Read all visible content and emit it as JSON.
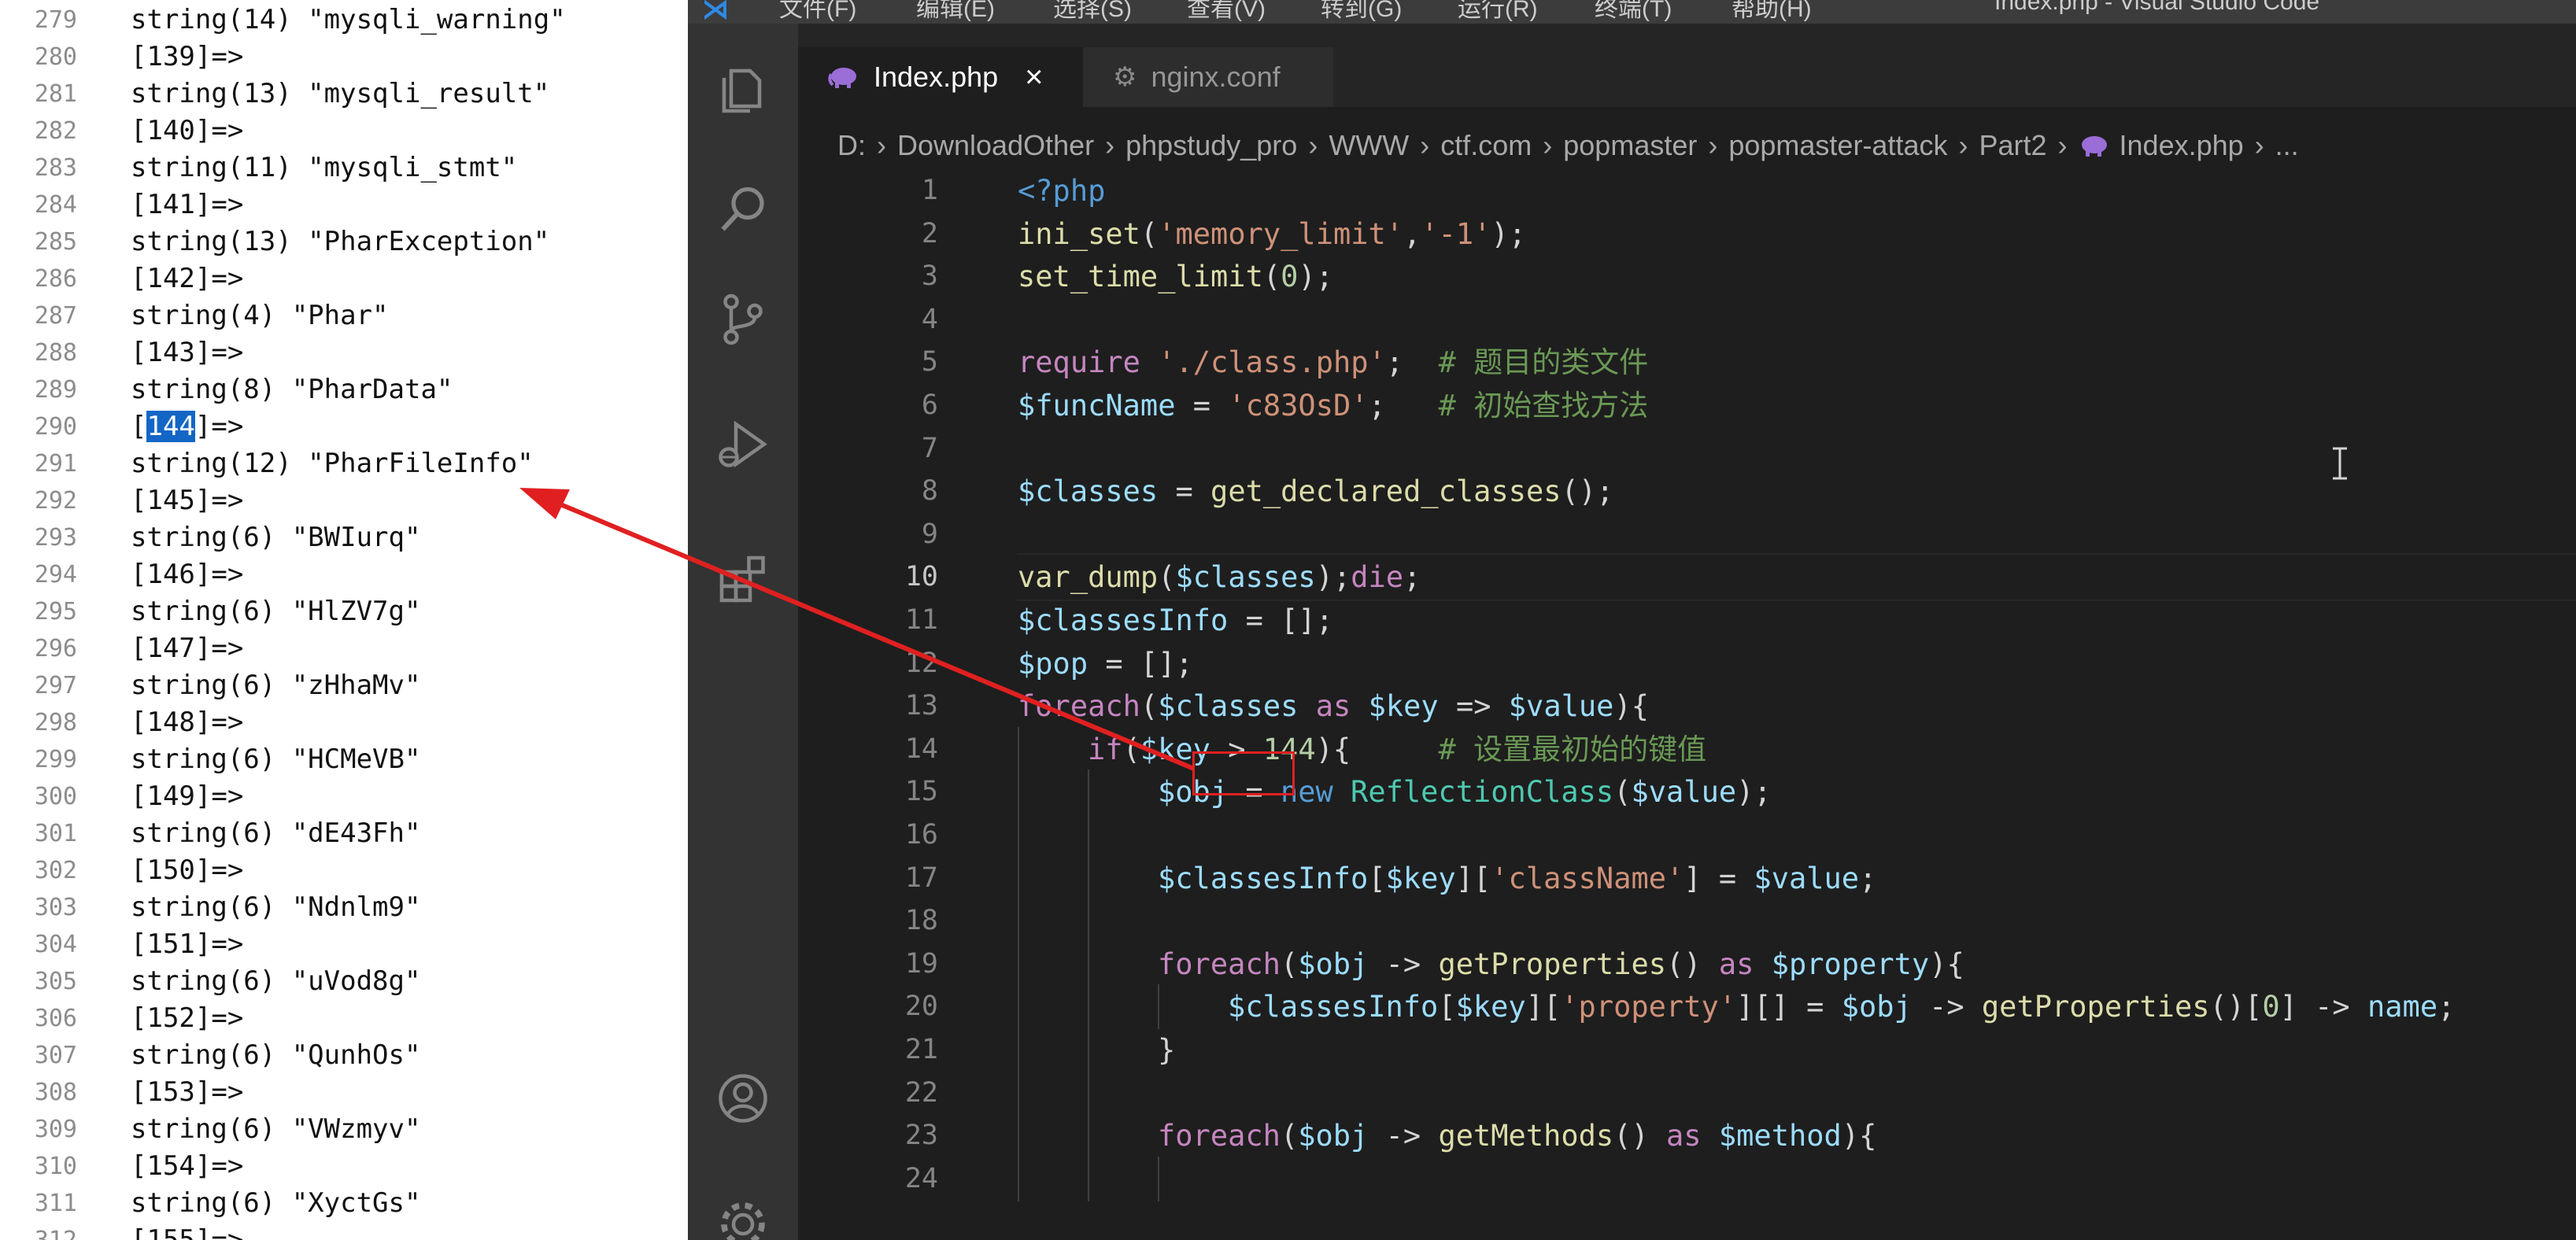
{
  "dump_panel": {
    "lines": [
      {
        "n": "279",
        "t": "string(14) \"mysqli_warning\""
      },
      {
        "n": "280",
        "t": "[139]=>"
      },
      {
        "n": "281",
        "t": "string(13) \"mysqli_result\""
      },
      {
        "n": "282",
        "t": "[140]=>"
      },
      {
        "n": "283",
        "t": "string(11) \"mysqli_stmt\""
      },
      {
        "n": "284",
        "t": "[141]=>"
      },
      {
        "n": "285",
        "t": "string(13) \"PharException\""
      },
      {
        "n": "286",
        "t": "[142]=>"
      },
      {
        "n": "287",
        "t": "string(4) \"Phar\""
      },
      {
        "n": "288",
        "t": "[143]=>"
      },
      {
        "n": "289",
        "t": "string(8) \"PharData\""
      },
      {
        "n": "290",
        "t": "]=>",
        "highlight_prefix": "[",
        "highlight": "144"
      },
      {
        "n": "291",
        "t": "string(12) \"PharFileInfo\""
      },
      {
        "n": "292",
        "t": "[145]=>"
      },
      {
        "n": "293",
        "t": "string(6) \"BWIurq\""
      },
      {
        "n": "294",
        "t": "[146]=>"
      },
      {
        "n": "295",
        "t": "string(6) \"HlZV7g\""
      },
      {
        "n": "296",
        "t": "[147]=>"
      },
      {
        "n": "297",
        "t": "string(6) \"zHhaMv\""
      },
      {
        "n": "298",
        "t": "[148]=>"
      },
      {
        "n": "299",
        "t": "string(6) \"HCMeVB\""
      },
      {
        "n": "300",
        "t": "[149]=>"
      },
      {
        "n": "301",
        "t": "string(6) \"dE43Fh\""
      },
      {
        "n": "302",
        "t": "[150]=>"
      },
      {
        "n": "303",
        "t": "string(6) \"Ndnlm9\""
      },
      {
        "n": "304",
        "t": "[151]=>"
      },
      {
        "n": "305",
        "t": "string(6) \"uVod8g\""
      },
      {
        "n": "306",
        "t": "[152]=>"
      },
      {
        "n": "307",
        "t": "string(6) \"QunhOs\""
      },
      {
        "n": "308",
        "t": "[153]=>"
      },
      {
        "n": "309",
        "t": "string(6) \"VWzmyv\""
      },
      {
        "n": "310",
        "t": "[154]=>"
      },
      {
        "n": "311",
        "t": "string(6) \"XyctGs\""
      },
      {
        "n": "312",
        "t": "[155]=>"
      }
    ]
  },
  "titlebar": {
    "menus": [
      "文件(F)",
      "编辑(E)",
      "选择(S)",
      "查看(V)",
      "转到(G)",
      "运行(R)",
      "终端(T)",
      "帮助(H)"
    ],
    "title": "Index.php - Visual Studio Code"
  },
  "activity_bar": {
    "icons": [
      "explorer-icon",
      "search-icon",
      "source-control-icon",
      "run-debug-icon",
      "extensions-icon",
      "account-icon",
      "settings-gear-icon"
    ]
  },
  "tabs": [
    {
      "label": "Index.php",
      "icon": "php-elephant-icon",
      "active": true,
      "close": "×"
    },
    {
      "label": "nginx.conf",
      "icon": "gear-file-icon",
      "active": false
    }
  ],
  "breadcrumb": {
    "parts": [
      "D:",
      "DownloadOther",
      "phpstudy_pro",
      "WWW",
      "ctf.com",
      "popmaster",
      "popmaster-attack",
      "Part2"
    ],
    "file": "Index.php",
    "ellipsis": "..."
  },
  "editor": {
    "current_line": 10,
    "lines": [
      {
        "n": "1",
        "tokens": [
          [
            "kw",
            "<?php"
          ]
        ]
      },
      {
        "n": "2",
        "tokens": [
          [
            "fn",
            "ini_set"
          ],
          [
            "txt",
            "("
          ],
          [
            "str",
            "'memory_limit'"
          ],
          [
            "txt",
            ","
          ],
          [
            "str",
            "'-1'"
          ],
          [
            "txt",
            ");"
          ]
        ]
      },
      {
        "n": "3",
        "tokens": [
          [
            "fn",
            "set_time_limit"
          ],
          [
            "txt",
            "("
          ],
          [
            "num",
            "0"
          ],
          [
            "txt",
            ");"
          ]
        ]
      },
      {
        "n": "4",
        "tokens": []
      },
      {
        "n": "5",
        "tokens": [
          [
            "ctl",
            "require"
          ],
          [
            "txt",
            " "
          ],
          [
            "str",
            "'./class.php'"
          ],
          [
            "txt",
            ";  "
          ],
          [
            "cmt",
            "# 题目的类文件"
          ]
        ]
      },
      {
        "n": "6",
        "tokens": [
          [
            "var",
            "$funcName"
          ],
          [
            "txt",
            " = "
          ],
          [
            "str",
            "'c83OsD'"
          ],
          [
            "txt",
            ";   "
          ],
          [
            "cmt",
            "# 初始查找方法"
          ]
        ]
      },
      {
        "n": "7",
        "tokens": []
      },
      {
        "n": "8",
        "tokens": [
          [
            "var",
            "$classes"
          ],
          [
            "txt",
            " = "
          ],
          [
            "fn",
            "get_declared_classes"
          ],
          [
            "txt",
            "();"
          ]
        ]
      },
      {
        "n": "9",
        "tokens": []
      },
      {
        "n": "10",
        "tokens": [
          [
            "fn",
            "var_dump"
          ],
          [
            "txt",
            "("
          ],
          [
            "var",
            "$classes"
          ],
          [
            "txt",
            ");"
          ],
          [
            "ctl",
            "die"
          ],
          [
            "txt",
            ";"
          ]
        ]
      },
      {
        "n": "11",
        "tokens": [
          [
            "var",
            "$classesInfo"
          ],
          [
            "txt",
            " = [];"
          ]
        ]
      },
      {
        "n": "12",
        "tokens": [
          [
            "var",
            "$pop"
          ],
          [
            "txt",
            " = [];"
          ]
        ]
      },
      {
        "n": "13",
        "tokens": [
          [
            "ctl",
            "foreach"
          ],
          [
            "txt",
            "("
          ],
          [
            "var",
            "$classes"
          ],
          [
            "txt",
            " "
          ],
          [
            "ctl",
            "as"
          ],
          [
            "txt",
            " "
          ],
          [
            "var",
            "$key"
          ],
          [
            "txt",
            " => "
          ],
          [
            "var",
            "$value"
          ],
          [
            "txt",
            "){"
          ]
        ]
      },
      {
        "n": "14",
        "indent": 1,
        "tokens": [
          [
            "ctl",
            "if"
          ],
          [
            "txt",
            "("
          ],
          [
            "var",
            "$key"
          ],
          [
            "txt",
            " > "
          ],
          [
            "num",
            "144"
          ],
          [
            "txt",
            "){     "
          ],
          [
            "cmt",
            "# 设置最初始的键值"
          ]
        ]
      },
      {
        "n": "15",
        "indent": 2,
        "tokens": [
          [
            "var",
            "$obj"
          ],
          [
            "txt",
            " = "
          ],
          [
            "kw",
            "new"
          ],
          [
            "txt",
            " "
          ],
          [
            "cls",
            "ReflectionClass"
          ],
          [
            "txt",
            "("
          ],
          [
            "var",
            "$value"
          ],
          [
            "txt",
            ");"
          ]
        ]
      },
      {
        "n": "16",
        "indent": 2,
        "tokens": []
      },
      {
        "n": "17",
        "indent": 2,
        "tokens": [
          [
            "var",
            "$classesInfo"
          ],
          [
            "txt",
            "["
          ],
          [
            "var",
            "$key"
          ],
          [
            "txt",
            "]["
          ],
          [
            "str",
            "'className'"
          ],
          [
            "txt",
            "] = "
          ],
          [
            "var",
            "$value"
          ],
          [
            "txt",
            ";"
          ]
        ]
      },
      {
        "n": "18",
        "indent": 2,
        "tokens": []
      },
      {
        "n": "19",
        "indent": 2,
        "tokens": [
          [
            "ctl",
            "foreach"
          ],
          [
            "txt",
            "("
          ],
          [
            "var",
            "$obj"
          ],
          [
            "txt",
            " -> "
          ],
          [
            "fn",
            "getProperties"
          ],
          [
            "txt",
            "() "
          ],
          [
            "ctl",
            "as"
          ],
          [
            "txt",
            " "
          ],
          [
            "var",
            "$property"
          ],
          [
            "txt",
            "){"
          ]
        ]
      },
      {
        "n": "20",
        "indent": 3,
        "tokens": [
          [
            "var",
            "$classesInfo"
          ],
          [
            "txt",
            "["
          ],
          [
            "var",
            "$key"
          ],
          [
            "txt",
            "]["
          ],
          [
            "str",
            "'property'"
          ],
          [
            "txt",
            "][] = "
          ],
          [
            "var",
            "$obj"
          ],
          [
            "txt",
            " -> "
          ],
          [
            "fn",
            "getProperties"
          ],
          [
            "txt",
            "()["
          ],
          [
            "num",
            "0"
          ],
          [
            "txt",
            "] -> "
          ],
          [
            "var",
            "name"
          ],
          [
            "txt",
            ";"
          ]
        ]
      },
      {
        "n": "21",
        "indent": 2,
        "tokens": [
          [
            "txt",
            "}"
          ]
        ]
      },
      {
        "n": "22",
        "indent": 2,
        "tokens": []
      },
      {
        "n": "23",
        "indent": 2,
        "tokens": [
          [
            "ctl",
            "foreach"
          ],
          [
            "txt",
            "("
          ],
          [
            "var",
            "$obj"
          ],
          [
            "txt",
            " -> "
          ],
          [
            "fn",
            "getMethods"
          ],
          [
            "txt",
            "() "
          ],
          [
            "ctl",
            "as"
          ],
          [
            "txt",
            " "
          ],
          [
            "var",
            "$method"
          ],
          [
            "txt",
            "){"
          ]
        ]
      },
      {
        "n": "24",
        "indent": 3,
        "tokens": []
      }
    ]
  },
  "annotation": {
    "arrow_color": "#e02020",
    "boxed_value": "144"
  },
  "colors": {
    "editor_bg": "#1e1e1e",
    "activity_bg": "#333333",
    "titlebar_bg": "#3c3c3c",
    "selection_blue": "#1366c6",
    "annotation_red": "#e02020"
  }
}
